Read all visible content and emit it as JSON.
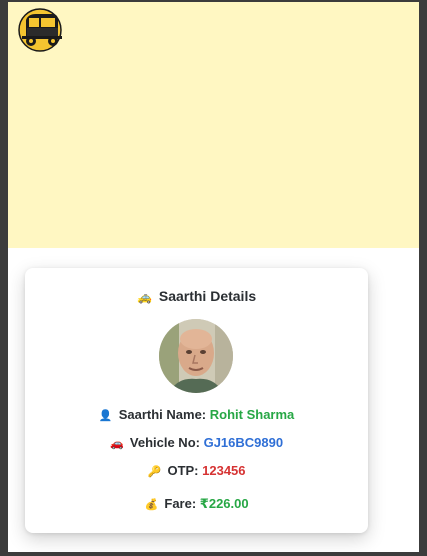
{
  "header": {
    "logo_icon": "auto-rickshaw-logo-icon"
  },
  "card": {
    "title_icon": "taxi-icon",
    "title": "Saarthi Details",
    "avatar_icon": "driver-avatar",
    "rows": {
      "name": {
        "icon": "person-icon",
        "label": "Saarthi Name:",
        "value": "Rohit Sharma"
      },
      "vehicle": {
        "icon": "car-icon",
        "label": "Vehicle No:",
        "value": "GJ16BC9890"
      },
      "otp": {
        "icon": "key-icon",
        "label": "OTP:",
        "value": "123456"
      },
      "fare": {
        "icon": "money-bag-icon",
        "label": "Fare:",
        "value": "₹226.00"
      }
    }
  },
  "colors": {
    "map_background": "#fff7c2",
    "accent_green": "#27a745",
    "accent_blue": "#2f6fd6",
    "accent_red": "#d63333",
    "text_dark": "#2b2f33"
  }
}
